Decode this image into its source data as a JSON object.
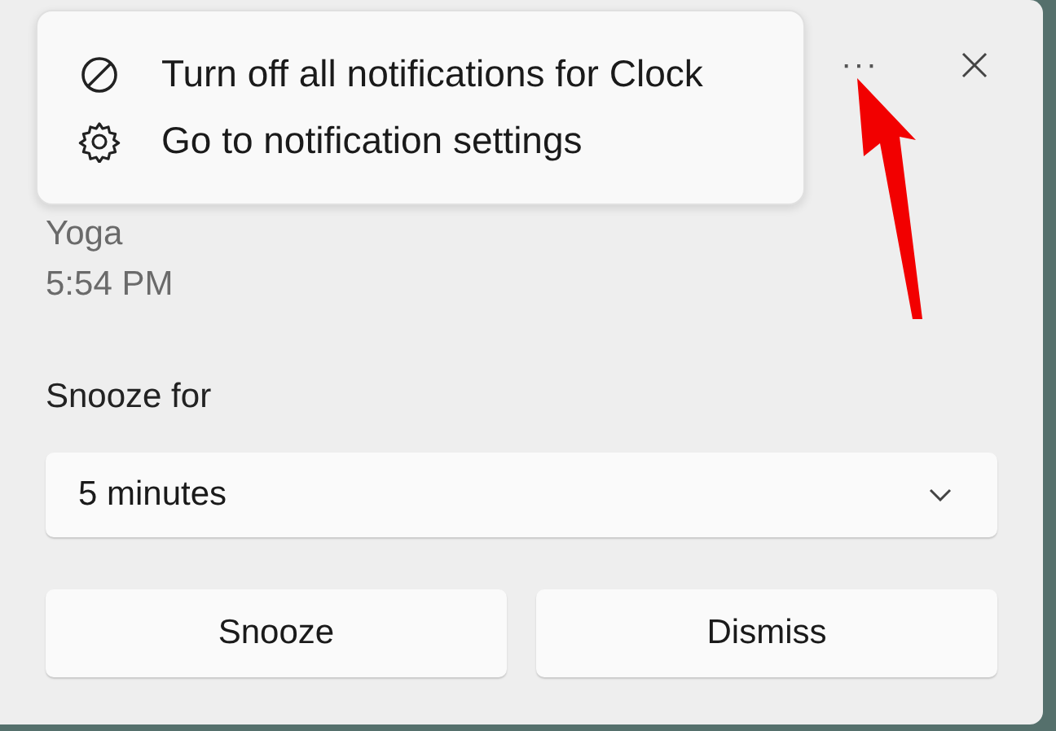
{
  "menu": {
    "items": [
      {
        "kind": "block",
        "label": "Turn off all notifications for Clock"
      },
      {
        "kind": "settings",
        "label": "Go to notification settings"
      }
    ]
  },
  "header": {
    "more": "···"
  },
  "notification": {
    "title": "Yoga",
    "time": "5:54 PM"
  },
  "snooze": {
    "label": "Snooze for",
    "value": "5 minutes"
  },
  "buttons": [
    "Snooze",
    "Dismiss"
  ]
}
